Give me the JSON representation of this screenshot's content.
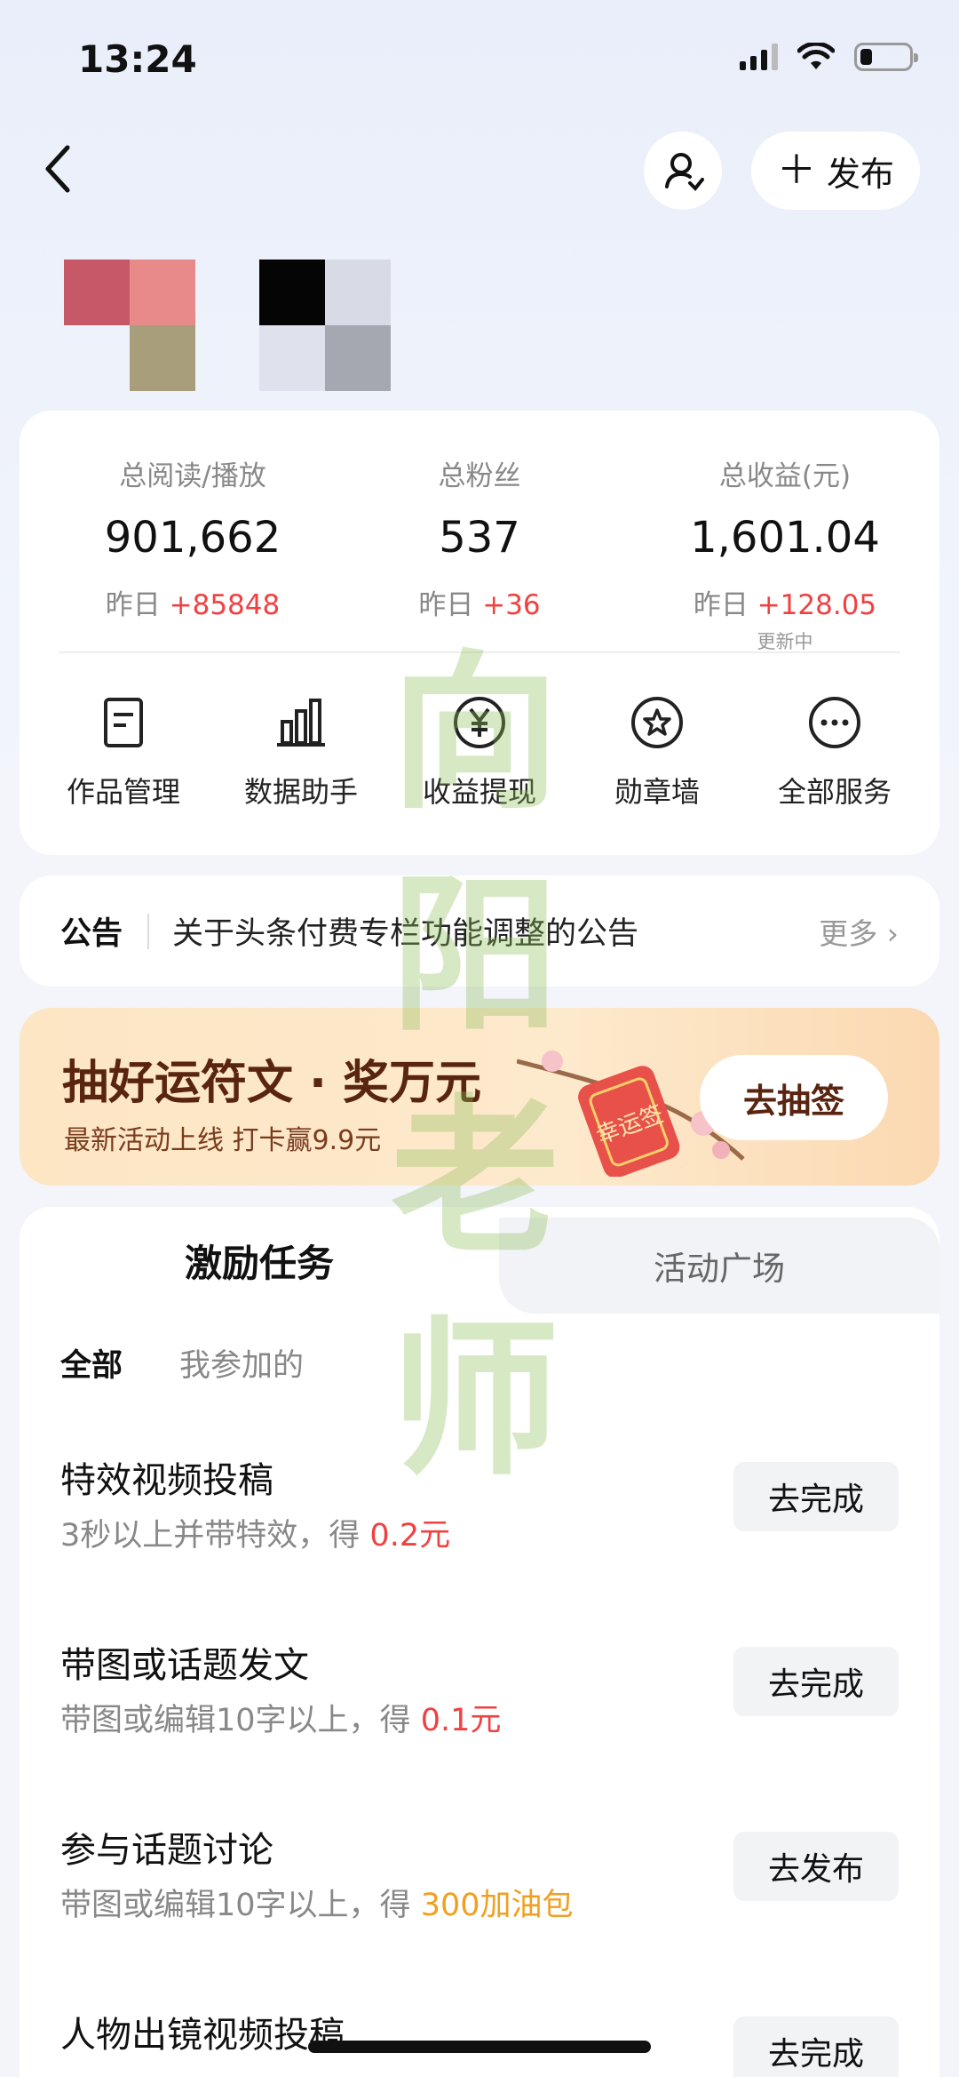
{
  "status_bar": {
    "time": "13:24",
    "battery_level": 0.25
  },
  "nav": {
    "publish_label": "发布"
  },
  "stats": [
    {
      "label": "总阅读/播放",
      "value": "901,662",
      "yesterday_label": "昨日",
      "delta": "+85848",
      "note": ""
    },
    {
      "label": "总粉丝",
      "value": "537",
      "yesterday_label": "昨日",
      "delta": "+36",
      "note": ""
    },
    {
      "label": "总收益(元)",
      "value": "1,601.04",
      "yesterday_label": "昨日",
      "delta": "+128.05",
      "note": "更新中"
    }
  ],
  "services": [
    {
      "label": "作品管理",
      "icon": "document-icon"
    },
    {
      "label": "数据助手",
      "icon": "bar-chart-icon"
    },
    {
      "label": "收益提现",
      "icon": "yen-icon"
    },
    {
      "label": "勋章墙",
      "icon": "medal-icon"
    },
    {
      "label": "全部服务",
      "icon": "more-icon"
    }
  ],
  "notice": {
    "tag": "公告",
    "text": "关于头条付费专栏功能调整的公告",
    "more": "更多"
  },
  "banner": {
    "title": "抽好运符文 · 奖万元",
    "subtitle": "最新活动上线 打卡赢9.9元",
    "button": "去抽签",
    "art_text": "幸运签"
  },
  "tabs": {
    "active": "激励任务",
    "inactive": "活动广场"
  },
  "filters": {
    "all": "全部",
    "joined": "我参加的"
  },
  "tasks": [
    {
      "title": "特效视频投稿",
      "desc": "3秒以上并带特效，得",
      "reward": "0.2元",
      "button": "去完成"
    },
    {
      "title": "带图或话题发文",
      "desc": "带图或编辑10字以上，得",
      "reward": "0.1元",
      "button": "去完成"
    },
    {
      "title": "参与话题讨论",
      "desc": "带图或编辑10字以上，得",
      "reward": "300加油包",
      "button": "去发布"
    },
    {
      "title": "人物出镜视频投稿",
      "desc": "",
      "reward": "",
      "button": "去完成"
    }
  ],
  "watermark": "向阳老师",
  "colors": {
    "accent_red": "#f04142",
    "reward_orange": "#f0a020",
    "banner_text": "#5a2510"
  }
}
